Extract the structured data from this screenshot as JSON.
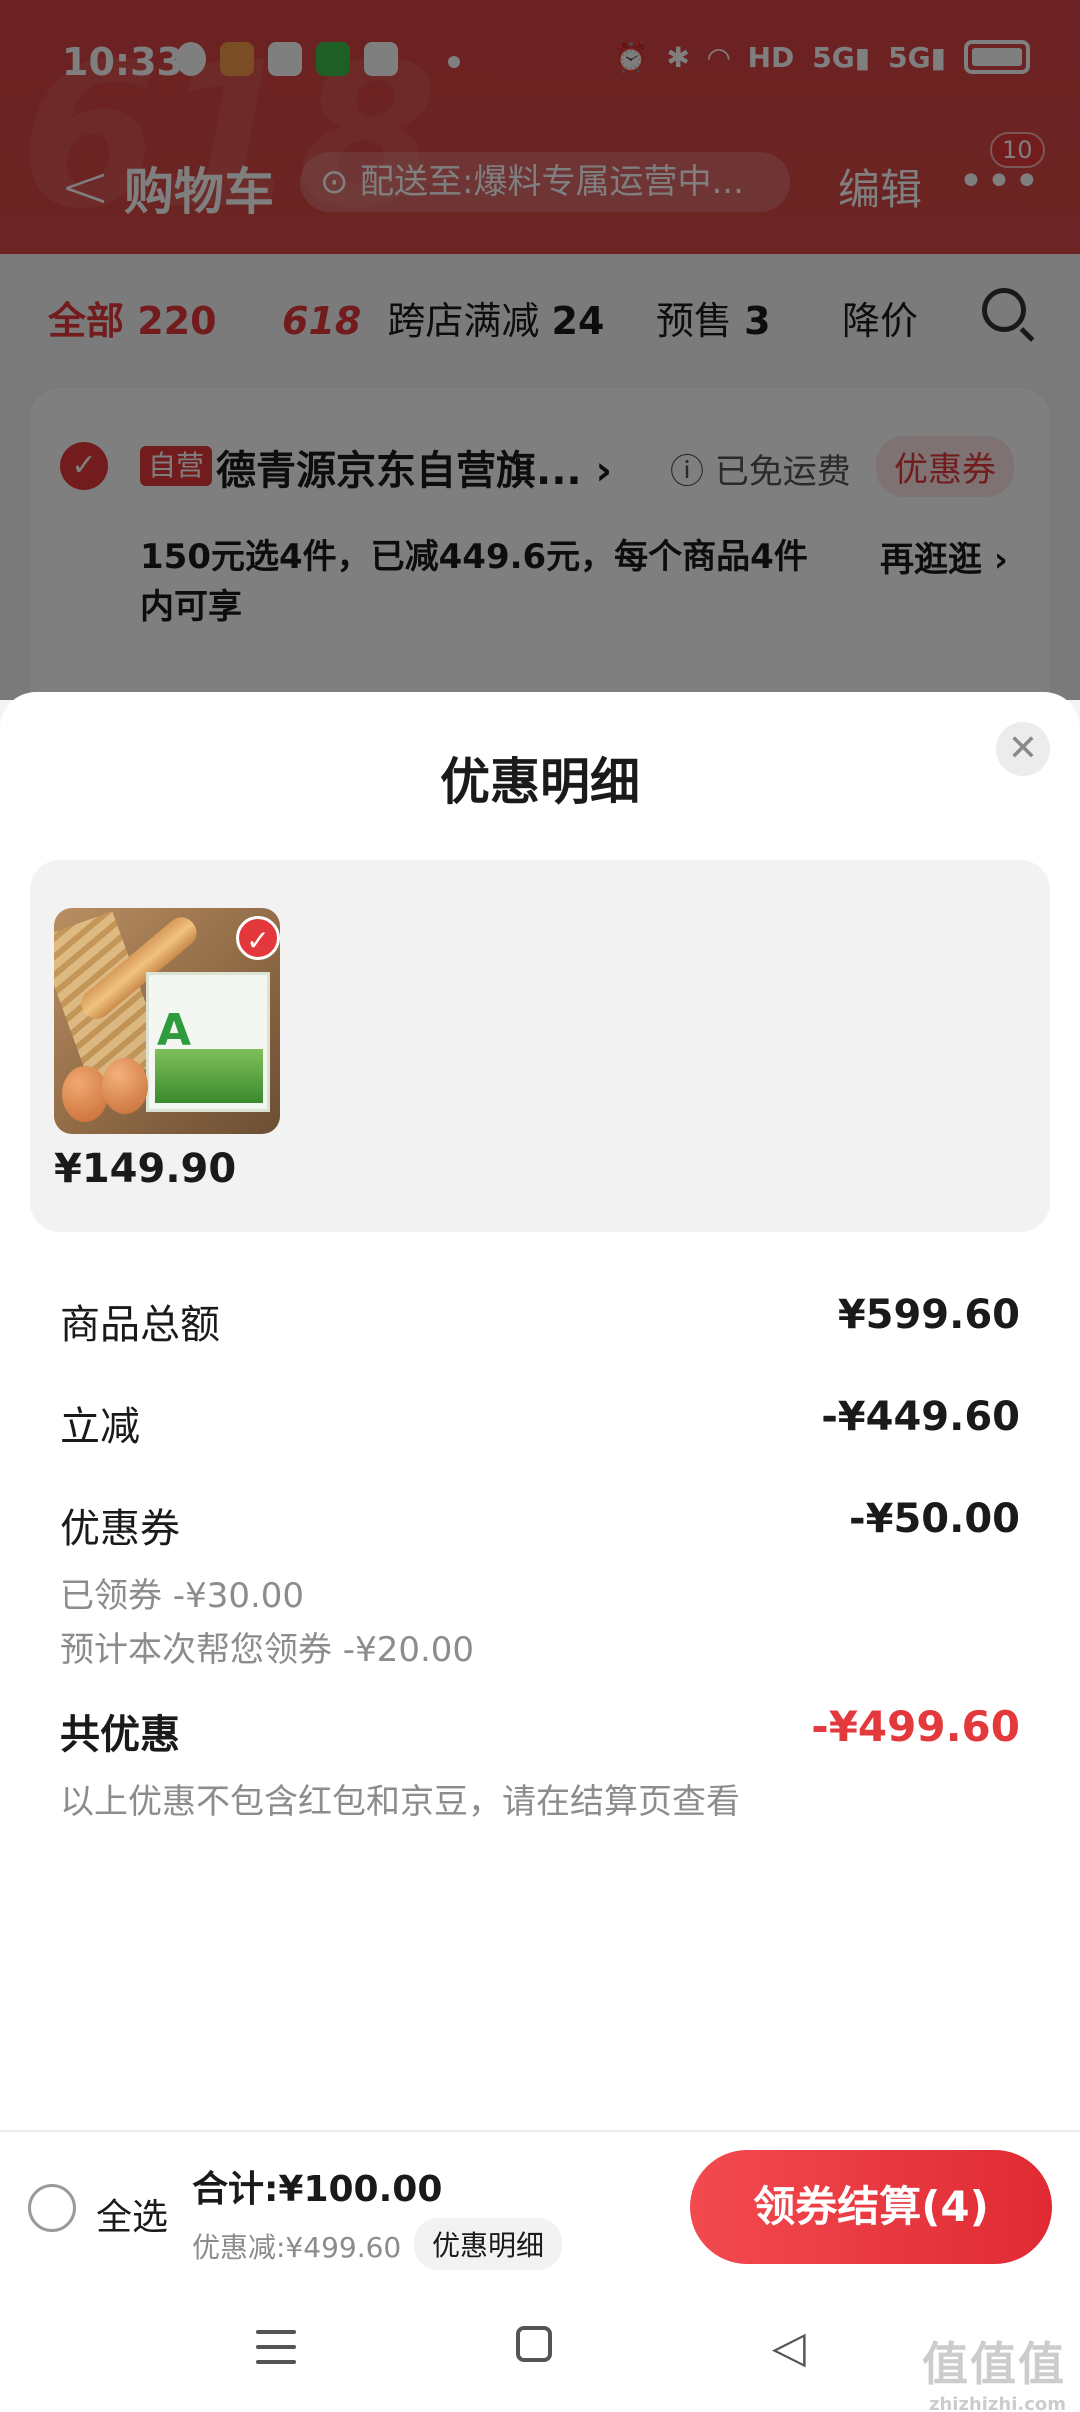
{
  "status_bar": {
    "time": "10:33"
  },
  "nav": {
    "title": "购物车",
    "address": "配送至:爆料专属运营中...",
    "edit": "编辑",
    "badge": "10"
  },
  "tabs": {
    "all_label": "全部",
    "all_count": "220",
    "tag_618": "618",
    "cross_label": "跨店满减",
    "cross_count": "24",
    "presale_label": "预售",
    "presale_count": "3",
    "price_drop_label": "降价"
  },
  "store": {
    "self_operated": "自营",
    "name": "德青源京东自营旗...",
    "free_shipping": "已免运费",
    "coupon": "优惠券",
    "promo": "150元选4件，已减449.6元，每个商品4件内可享",
    "more_shop": "再逛逛"
  },
  "sheet": {
    "title": "优惠明细",
    "product_price": "¥149.90",
    "rows": {
      "total_label": "商品总额",
      "total_value": "¥599.60",
      "instant_label": "立减",
      "instant_value": "-¥449.60",
      "coupon_label": "优惠券",
      "coupon_value": "-¥50.00",
      "coupon_claimed": "已领券 -¥30.00",
      "coupon_estimated": "预计本次帮您领券 -¥20.00",
      "saving_label": "共优惠",
      "saving_value": "-¥499.60"
    },
    "note": "以上优惠不包含红包和京豆，请在结算页查看"
  },
  "bottom": {
    "select_all": "全选",
    "sum": "合计:¥100.00",
    "discount": "优惠减:¥499.60",
    "detail": "优惠明细",
    "checkout": "领券结算(4)"
  },
  "watermark": {
    "main": "值值值",
    "url": "zhizhizhi.com"
  },
  "colors": {
    "accent": "#e4393c",
    "header": "#d94444"
  }
}
